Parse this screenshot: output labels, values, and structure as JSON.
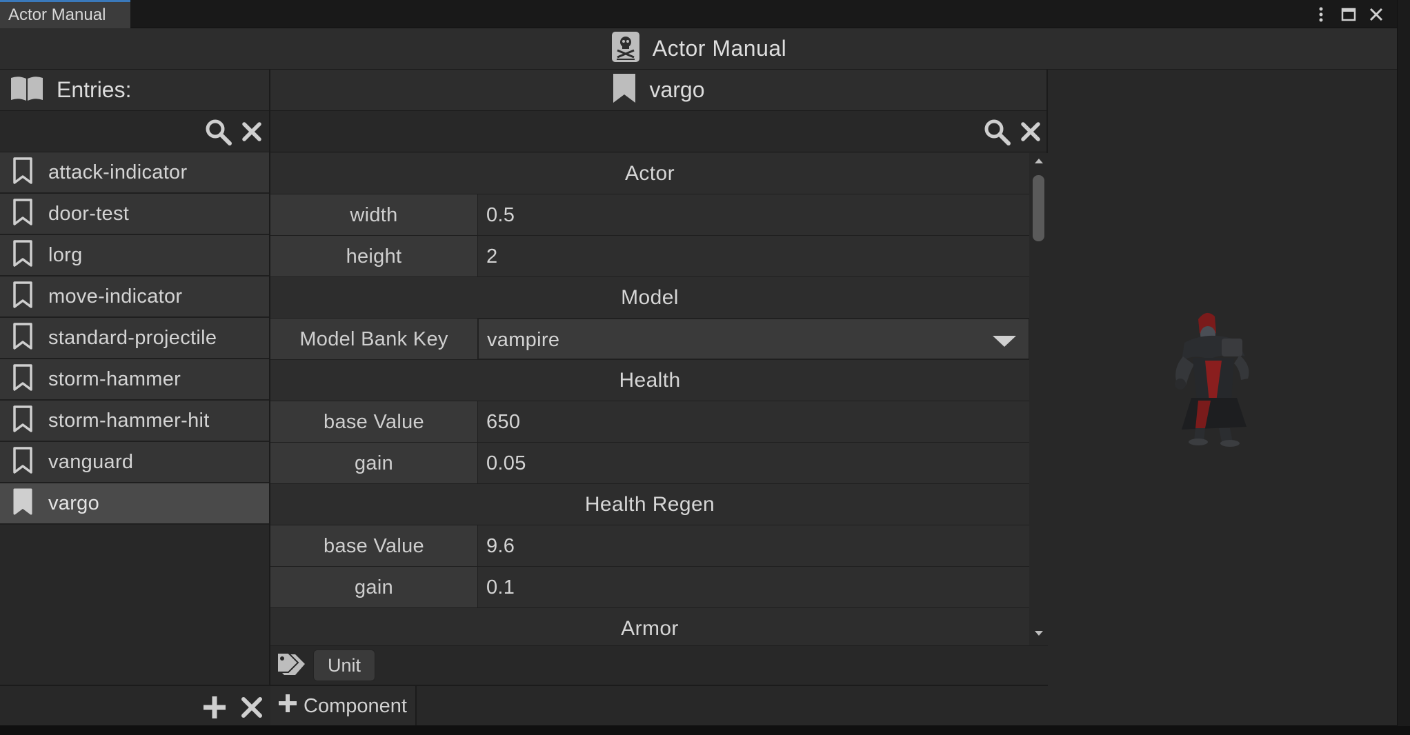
{
  "window": {
    "tab_title": "Actor Manual"
  },
  "header": {
    "title": "Actor Manual",
    "icon": "skull-document-icon"
  },
  "entries_panel": {
    "label": "Entries:",
    "items": [
      {
        "label": "attack-indicator"
      },
      {
        "label": "door-test"
      },
      {
        "label": "lorg"
      },
      {
        "label": "move-indicator"
      },
      {
        "label": "standard-projectile"
      },
      {
        "label": "storm-hammer"
      },
      {
        "label": "storm-hammer-hit"
      },
      {
        "label": "vanguard"
      },
      {
        "label": "vargo",
        "selected": true
      }
    ]
  },
  "detail": {
    "title": "vargo",
    "sections": {
      "actor": "Actor",
      "model": "Model",
      "health": "Health",
      "health_regen": "Health Regen",
      "armor": "Armor"
    },
    "fields": {
      "width": {
        "key": "width",
        "value": "0.5"
      },
      "height": {
        "key": "height",
        "value": "2"
      },
      "model_bank_key": {
        "key": "Model Bank Key",
        "value": "vampire"
      },
      "health_base": {
        "key": "base Value",
        "value": "650"
      },
      "health_gain": {
        "key": "gain",
        "value": "0.05"
      },
      "regen_base": {
        "key": "base Value",
        "value": "9.6"
      },
      "regen_gain": {
        "key": "gain",
        "value": "0.1"
      }
    },
    "tags": [
      "Unit"
    ],
    "add_component_label": "Component"
  },
  "colors": {
    "accent": "#3a79bb",
    "background": "#282828",
    "selected_row": "#4a4a4a"
  }
}
